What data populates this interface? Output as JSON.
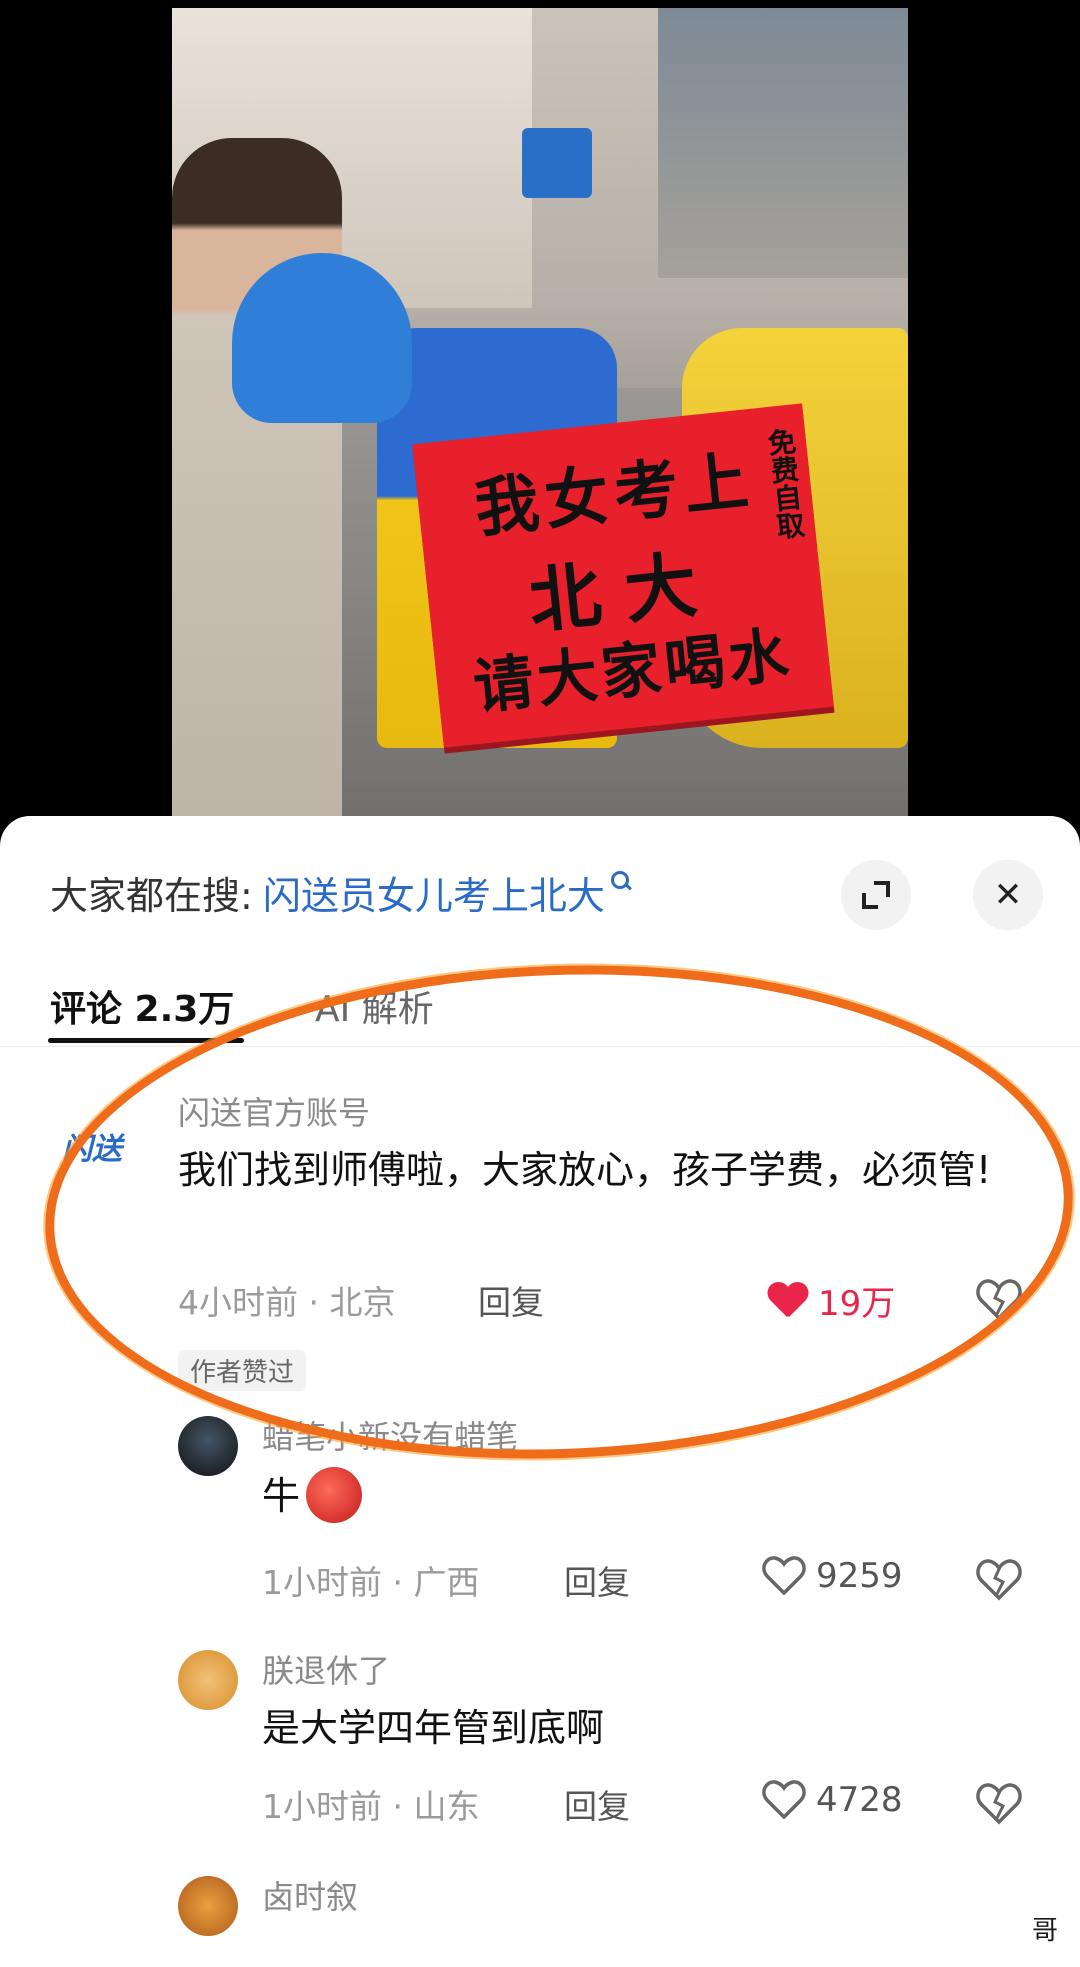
{
  "video": {
    "sign_lines": [
      "我女考上",
      "北大",
      "请大家喝水"
    ],
    "sign_side": "免费自取"
  },
  "search": {
    "prefix": "大家都在搜:",
    "term": "闪送员女儿考上北大"
  },
  "tabs": {
    "comments_label": "评论 2.3万",
    "ai_label": "AI 解析"
  },
  "comments": [
    {
      "username": "闪送官方账号",
      "avatar_text": "闪送",
      "text": "我们找到师傅啦，大家放心，孩子学费，必须管!",
      "time_location": "4小时前 · 北京",
      "reply_label": "回复",
      "likes": "19万",
      "liked": true,
      "badge": "作者赞过"
    },
    {
      "username": "蜡笔小新没有蜡笔",
      "text": "牛",
      "time_location": "1小时前 · 广西",
      "reply_label": "回复",
      "likes": "9259",
      "liked": false
    },
    {
      "username": "朕退休了",
      "text": "是大学四年管到底啊",
      "time_location": "1小时前 · 山东",
      "reply_label": "回复",
      "likes": "4728",
      "liked": false
    },
    {
      "username": "卤时叙",
      "text": "",
      "time_location": "",
      "reply_label": "",
      "likes": "",
      "liked": false
    }
  ],
  "watermark": "哥",
  "colors": {
    "accent_blue": "#2a6bc8",
    "like_red": "#e9264a",
    "highlight_orange": "#ef6c1a"
  },
  "icons": [
    "search-icon",
    "expand-icon",
    "close-icon",
    "heart-icon",
    "dislike-icon"
  ]
}
